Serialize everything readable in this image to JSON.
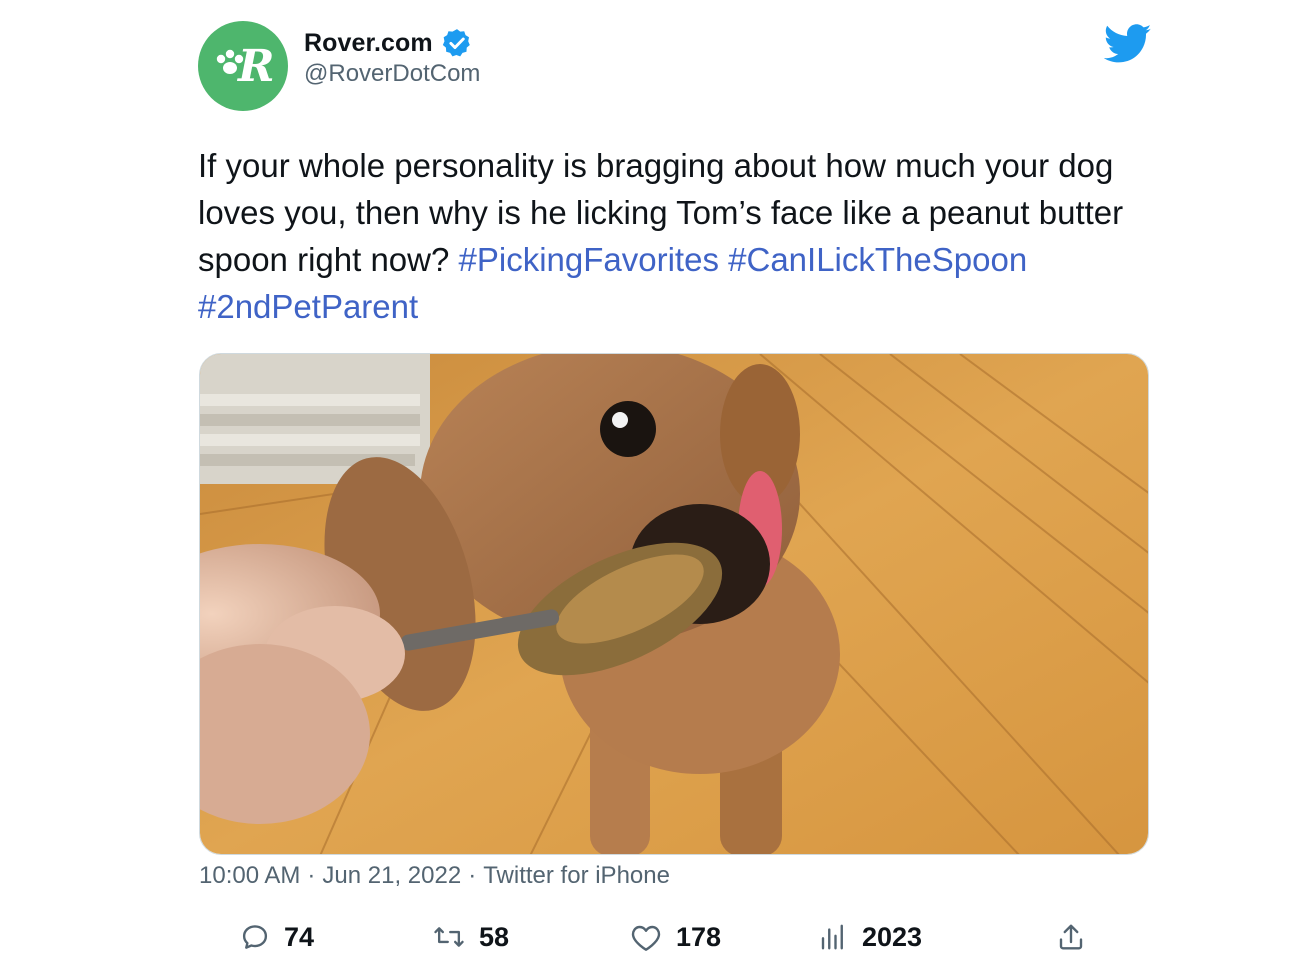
{
  "author": {
    "display_name": "Rover.com",
    "handle": "@RoverDotCom",
    "verified": true,
    "avatar_letter": "R",
    "avatar_color": "#4eb66d"
  },
  "tweet": {
    "text_plain": "If your whole personality is bragging about how much your dog loves you, then why is he licking Tom’s face like a peanut butter spoon right now? ",
    "hashtags": [
      "#PickingFavorites",
      "#CanILickTheSpoon",
      "#2ndPetParent"
    ],
    "media_icon": "dog-licking-spoon-image"
  },
  "meta": {
    "time": "10:00 AM",
    "separator": "·",
    "date": "Jun 21, 2022",
    "source": "Twitter for iPhone"
  },
  "actions": {
    "reply_count": "74",
    "retweet_count": "58",
    "like_count": "178",
    "views_count": "2023"
  },
  "colors": {
    "twitter_blue": "#1d9bf0",
    "hashtag": "#3f63c6",
    "secondary_text": "#536471"
  }
}
